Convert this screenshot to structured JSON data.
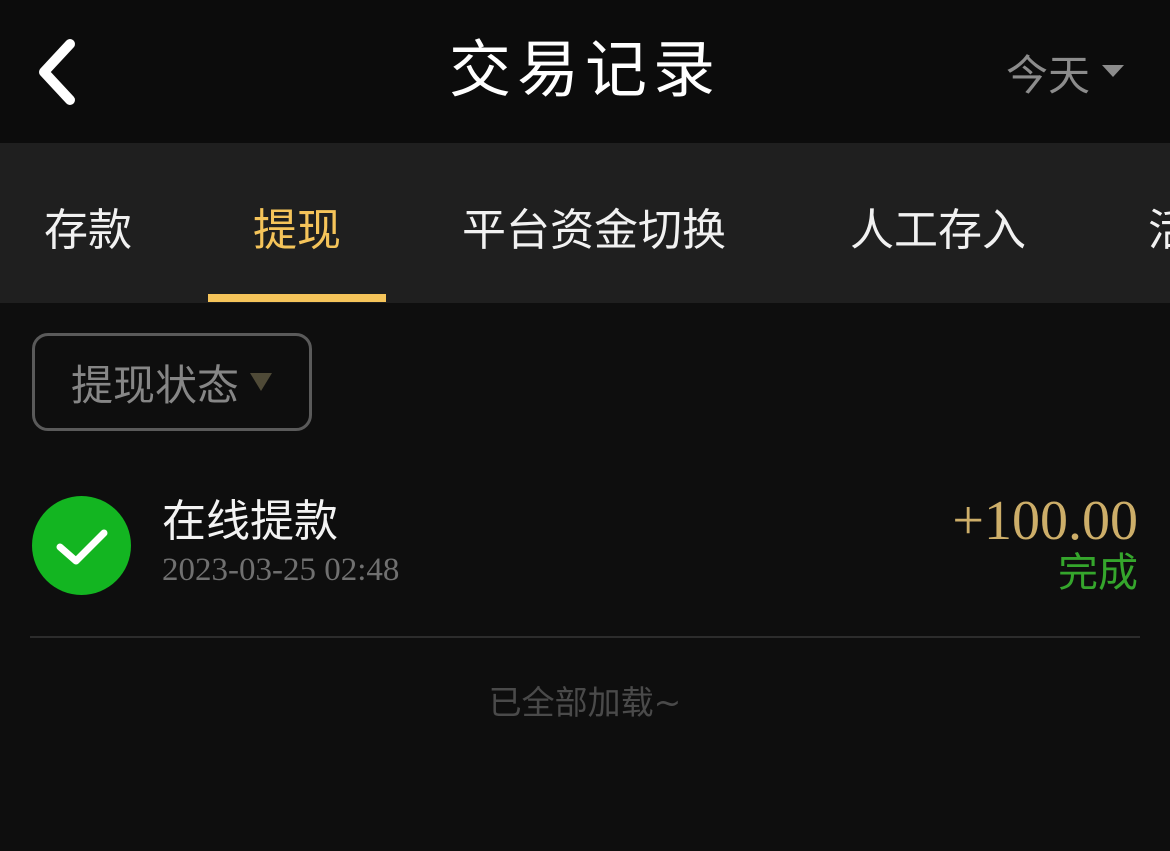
{
  "header": {
    "title": "交易记录",
    "date_filter": "今天"
  },
  "tabs": [
    {
      "label": "存款"
    },
    {
      "label": "提现"
    },
    {
      "label": "平台资金切换"
    },
    {
      "label": "人工存入"
    },
    {
      "label": "活"
    }
  ],
  "active_tab_index": 1,
  "status_filter": {
    "label": "提现状态"
  },
  "records": [
    {
      "title": "在线提款",
      "time": "2023-03-25 02:48",
      "amount": "+100.00",
      "status": "完成"
    }
  ],
  "footer": {
    "load_end": "已全部加载~"
  },
  "colors": {
    "background": "#0e0e0e",
    "accent": "#f5c45a",
    "amount": "#cdae69",
    "success": "#13b521",
    "success_text": "#35a62c"
  },
  "icons": {
    "back": "chevron-left-icon",
    "dropdown": "caret-down-icon",
    "status": "check-circle-icon"
  }
}
